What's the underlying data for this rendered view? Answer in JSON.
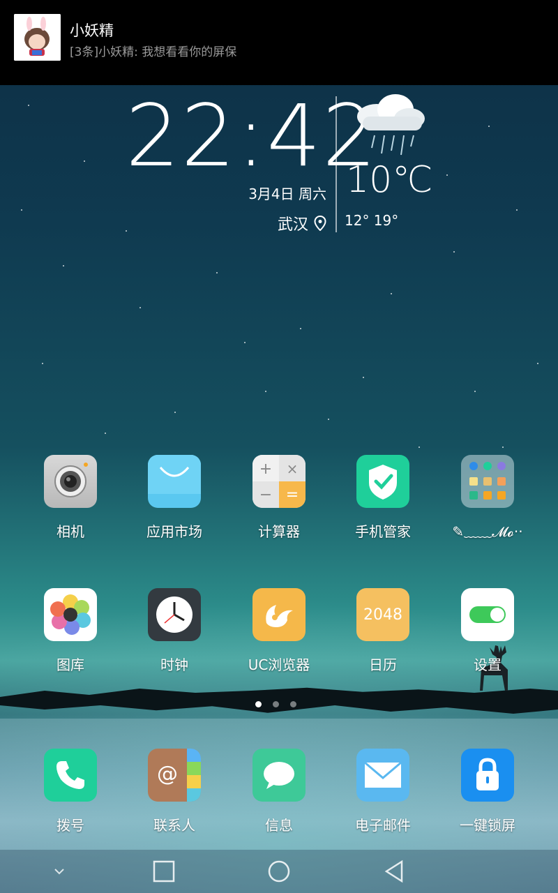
{
  "notification": {
    "title": "小妖精",
    "body": "[3条]小妖精: 我想看看你的屏保"
  },
  "clock": {
    "time": "22:42",
    "date": "3月4日   周六",
    "city": "武汉"
  },
  "weather": {
    "temp": "10℃",
    "range": "12°  19°",
    "icon": "rain-cloud-icon"
  },
  "apps_row1": [
    {
      "label": "相机",
      "icon": "camera-icon"
    },
    {
      "label": "应用市场",
      "icon": "app-market-icon"
    },
    {
      "label": "计算器",
      "icon": "calculator-icon"
    },
    {
      "label": "手机管家",
      "icon": "phone-manager-icon"
    },
    {
      "label": "✎﹏﹏𝓜𝓸··",
      "icon": "folder-icon"
    }
  ],
  "apps_row2": [
    {
      "label": "图库",
      "icon": "gallery-icon"
    },
    {
      "label": "时钟",
      "icon": "clock-icon"
    },
    {
      "label": "UC浏览器",
      "icon": "uc-browser-icon"
    },
    {
      "label": "日历",
      "icon": "calendar-icon",
      "badge": "2048"
    },
    {
      "label": "设置",
      "icon": "settings-icon"
    }
  ],
  "dock": [
    {
      "label": "拨号",
      "icon": "phone-icon"
    },
    {
      "label": "联系人",
      "icon": "contacts-icon"
    },
    {
      "label": "信息",
      "icon": "messages-icon"
    },
    {
      "label": "电子邮件",
      "icon": "email-icon"
    },
    {
      "label": "一键锁屏",
      "icon": "lock-icon"
    }
  ],
  "page_indicator": {
    "count": 3,
    "active": 0
  }
}
